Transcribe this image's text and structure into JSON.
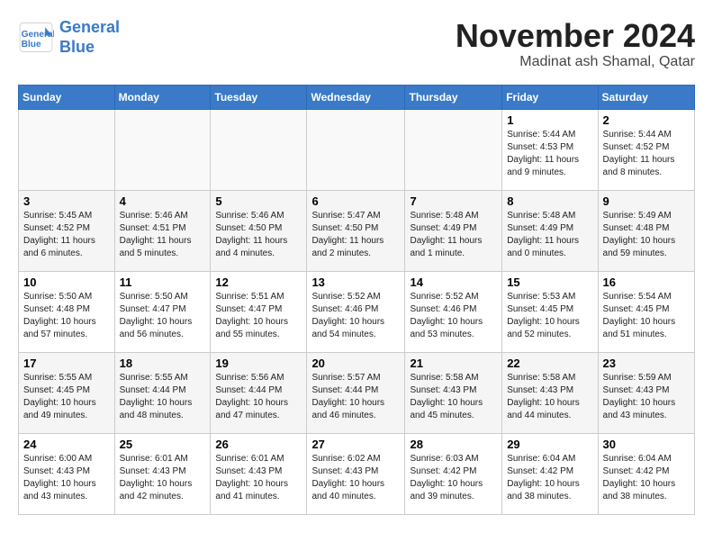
{
  "header": {
    "logo_line1": "General",
    "logo_line2": "Blue",
    "month": "November 2024",
    "location": "Madinat ash Shamal, Qatar"
  },
  "weekdays": [
    "Sunday",
    "Monday",
    "Tuesday",
    "Wednesday",
    "Thursday",
    "Friday",
    "Saturday"
  ],
  "weeks": [
    [
      {
        "day": "",
        "info": ""
      },
      {
        "day": "",
        "info": ""
      },
      {
        "day": "",
        "info": ""
      },
      {
        "day": "",
        "info": ""
      },
      {
        "day": "",
        "info": ""
      },
      {
        "day": "1",
        "info": "Sunrise: 5:44 AM\nSunset: 4:53 PM\nDaylight: 11 hours and 9 minutes."
      },
      {
        "day": "2",
        "info": "Sunrise: 5:44 AM\nSunset: 4:52 PM\nDaylight: 11 hours and 8 minutes."
      }
    ],
    [
      {
        "day": "3",
        "info": "Sunrise: 5:45 AM\nSunset: 4:52 PM\nDaylight: 11 hours and 6 minutes."
      },
      {
        "day": "4",
        "info": "Sunrise: 5:46 AM\nSunset: 4:51 PM\nDaylight: 11 hours and 5 minutes."
      },
      {
        "day": "5",
        "info": "Sunrise: 5:46 AM\nSunset: 4:50 PM\nDaylight: 11 hours and 4 minutes."
      },
      {
        "day": "6",
        "info": "Sunrise: 5:47 AM\nSunset: 4:50 PM\nDaylight: 11 hours and 2 minutes."
      },
      {
        "day": "7",
        "info": "Sunrise: 5:48 AM\nSunset: 4:49 PM\nDaylight: 11 hours and 1 minute."
      },
      {
        "day": "8",
        "info": "Sunrise: 5:48 AM\nSunset: 4:49 PM\nDaylight: 11 hours and 0 minutes."
      },
      {
        "day": "9",
        "info": "Sunrise: 5:49 AM\nSunset: 4:48 PM\nDaylight: 10 hours and 59 minutes."
      }
    ],
    [
      {
        "day": "10",
        "info": "Sunrise: 5:50 AM\nSunset: 4:48 PM\nDaylight: 10 hours and 57 minutes."
      },
      {
        "day": "11",
        "info": "Sunrise: 5:50 AM\nSunset: 4:47 PM\nDaylight: 10 hours and 56 minutes."
      },
      {
        "day": "12",
        "info": "Sunrise: 5:51 AM\nSunset: 4:47 PM\nDaylight: 10 hours and 55 minutes."
      },
      {
        "day": "13",
        "info": "Sunrise: 5:52 AM\nSunset: 4:46 PM\nDaylight: 10 hours and 54 minutes."
      },
      {
        "day": "14",
        "info": "Sunrise: 5:52 AM\nSunset: 4:46 PM\nDaylight: 10 hours and 53 minutes."
      },
      {
        "day": "15",
        "info": "Sunrise: 5:53 AM\nSunset: 4:45 PM\nDaylight: 10 hours and 52 minutes."
      },
      {
        "day": "16",
        "info": "Sunrise: 5:54 AM\nSunset: 4:45 PM\nDaylight: 10 hours and 51 minutes."
      }
    ],
    [
      {
        "day": "17",
        "info": "Sunrise: 5:55 AM\nSunset: 4:45 PM\nDaylight: 10 hours and 49 minutes."
      },
      {
        "day": "18",
        "info": "Sunrise: 5:55 AM\nSunset: 4:44 PM\nDaylight: 10 hours and 48 minutes."
      },
      {
        "day": "19",
        "info": "Sunrise: 5:56 AM\nSunset: 4:44 PM\nDaylight: 10 hours and 47 minutes."
      },
      {
        "day": "20",
        "info": "Sunrise: 5:57 AM\nSunset: 4:44 PM\nDaylight: 10 hours and 46 minutes."
      },
      {
        "day": "21",
        "info": "Sunrise: 5:58 AM\nSunset: 4:43 PM\nDaylight: 10 hours and 45 minutes."
      },
      {
        "day": "22",
        "info": "Sunrise: 5:58 AM\nSunset: 4:43 PM\nDaylight: 10 hours and 44 minutes."
      },
      {
        "day": "23",
        "info": "Sunrise: 5:59 AM\nSunset: 4:43 PM\nDaylight: 10 hours and 43 minutes."
      }
    ],
    [
      {
        "day": "24",
        "info": "Sunrise: 6:00 AM\nSunset: 4:43 PM\nDaylight: 10 hours and 43 minutes."
      },
      {
        "day": "25",
        "info": "Sunrise: 6:01 AM\nSunset: 4:43 PM\nDaylight: 10 hours and 42 minutes."
      },
      {
        "day": "26",
        "info": "Sunrise: 6:01 AM\nSunset: 4:43 PM\nDaylight: 10 hours and 41 minutes."
      },
      {
        "day": "27",
        "info": "Sunrise: 6:02 AM\nSunset: 4:43 PM\nDaylight: 10 hours and 40 minutes."
      },
      {
        "day": "28",
        "info": "Sunrise: 6:03 AM\nSunset: 4:42 PM\nDaylight: 10 hours and 39 minutes."
      },
      {
        "day": "29",
        "info": "Sunrise: 6:04 AM\nSunset: 4:42 PM\nDaylight: 10 hours and 38 minutes."
      },
      {
        "day": "30",
        "info": "Sunrise: 6:04 AM\nSunset: 4:42 PM\nDaylight: 10 hours and 38 minutes."
      }
    ]
  ]
}
